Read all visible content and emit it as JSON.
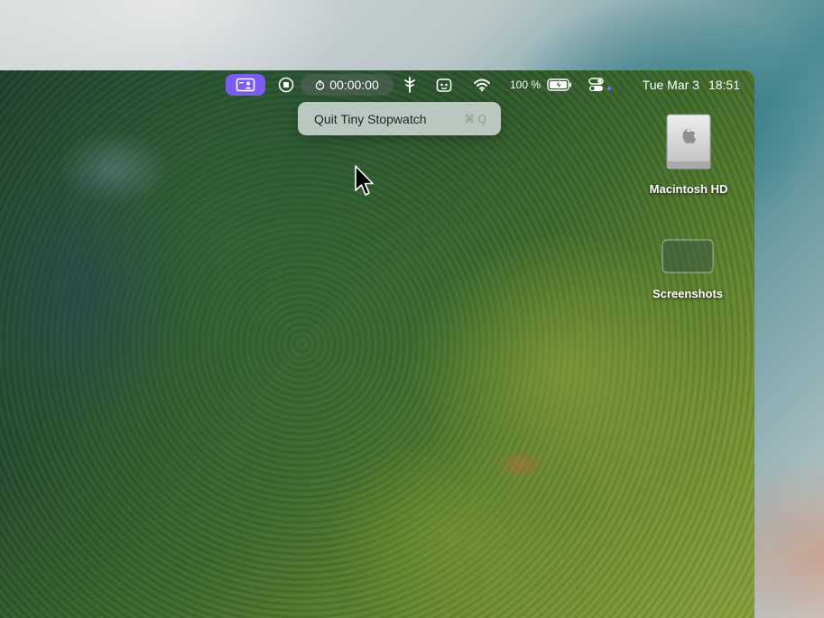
{
  "menubar": {
    "timer": "00:00:00",
    "battery_percent": "100 %",
    "date": "Tue Mar 3",
    "time": "18:51",
    "app_accent_color": "#7c5cf0"
  },
  "menu": {
    "item_label": "Quit Tiny Stopwatch",
    "item_shortcut": "⌘ Q"
  },
  "desktop": {
    "icons": [
      {
        "label": "Macintosh HD",
        "icon": "hard-drive-icon"
      },
      {
        "label": "Screenshots",
        "icon": "folder-icon"
      }
    ]
  }
}
